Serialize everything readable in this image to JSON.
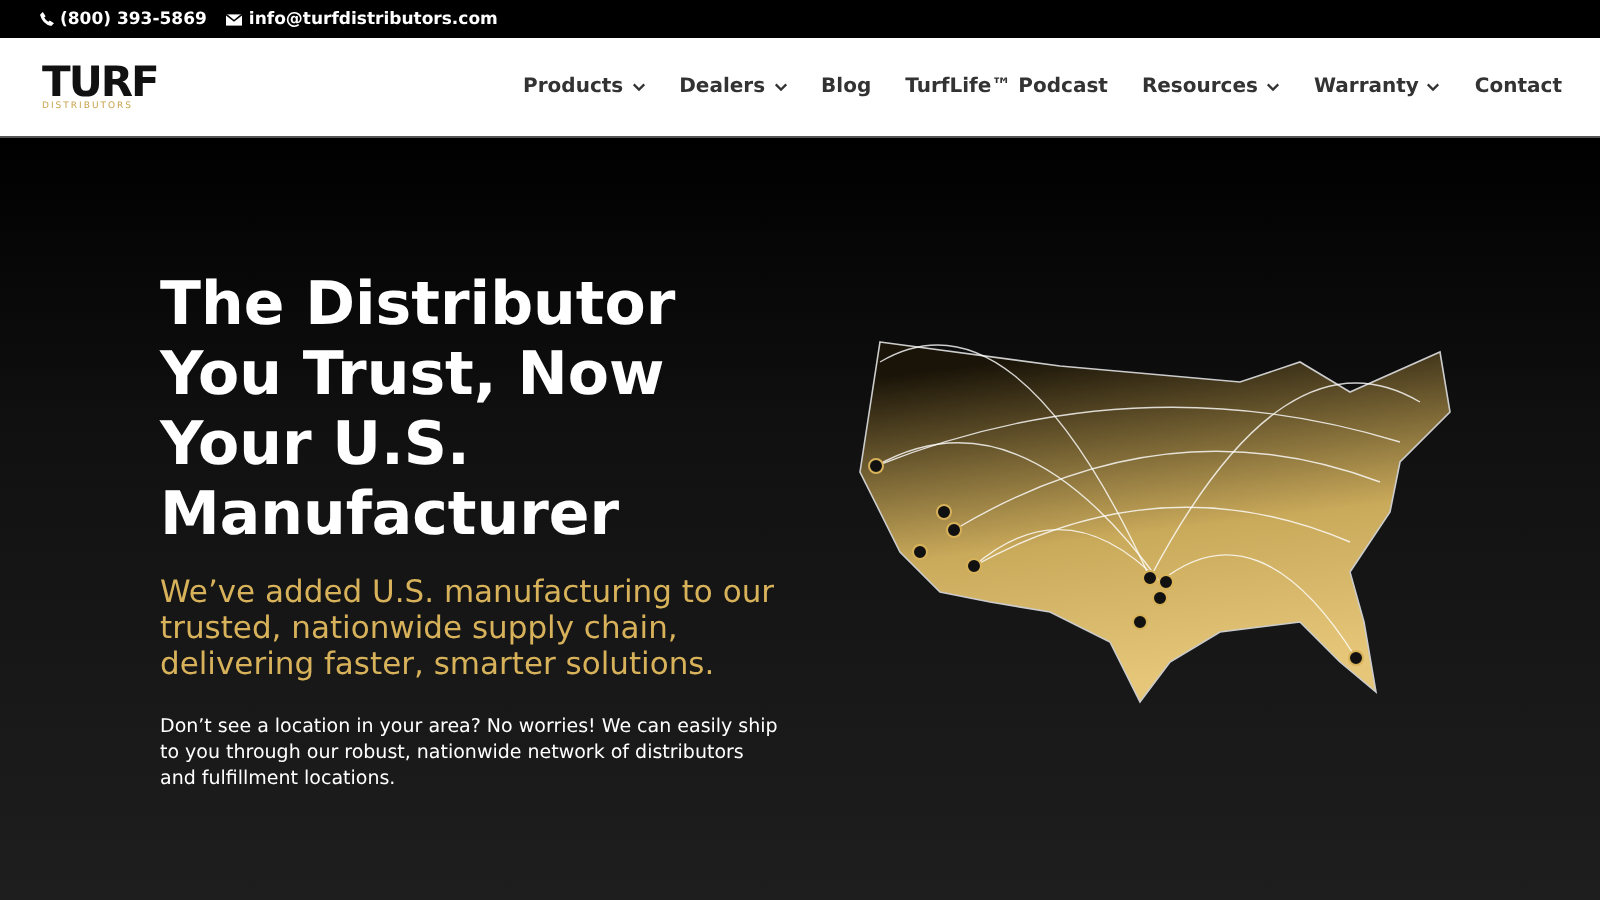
{
  "top_bar": {
    "phone": "(800) 393-5869",
    "email": "info@turfdistributors.com"
  },
  "logo": {
    "name": "TURF",
    "tagline": "DISTRIBUTORS"
  },
  "nav": [
    {
      "label": "Products",
      "dropdown": true
    },
    {
      "label": "Dealers",
      "dropdown": true
    },
    {
      "label": "Blog",
      "dropdown": false
    },
    {
      "label": "TurfLife™ Podcast",
      "dropdown": false
    },
    {
      "label": "Resources",
      "dropdown": true
    },
    {
      "label": "Warranty",
      "dropdown": true
    },
    {
      "label": "Contact",
      "dropdown": false
    }
  ],
  "hero": {
    "title": "The Distributor You Trust, Now Your U.S. Manufacturer",
    "subtitle": "We’ve added U.S. manufacturing to our trusted, nationwide supply chain, delivering faster, smarter solutions.",
    "body": "Don’t see a location in your area? No worries! We can easily ship to you through our robust, nationwide network of distributors and fulfillment locations."
  }
}
